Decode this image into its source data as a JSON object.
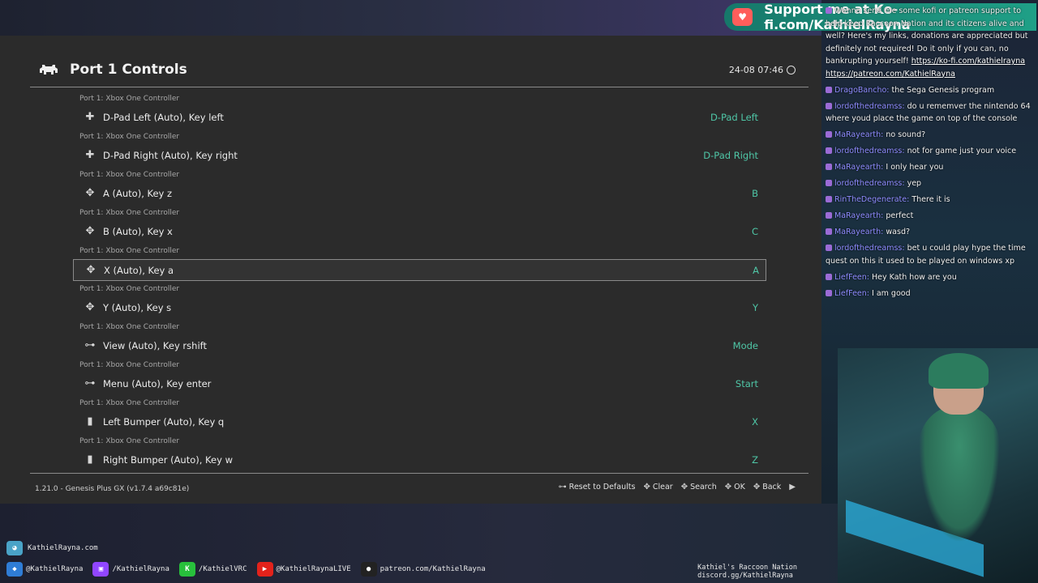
{
  "window": {
    "title": "Port 1 Controls",
    "clock": "24-08 07:46",
    "version": "1.21.0 - Genesis Plus GX (v1.7.4 a69c81e)"
  },
  "entries": [
    {
      "sub": "Port 1: Xbox One Controller",
      "label": "D-Pad Left (Auto), Key left",
      "value": "D-Pad Left",
      "icon": "dpad-left-icon"
    },
    {
      "sub": "Port 1: Xbox One Controller",
      "label": "D-Pad Right (Auto), Key right",
      "value": "D-Pad Right",
      "icon": "dpad-right-icon"
    },
    {
      "sub": "Port 1: Xbox One Controller",
      "label": "A (Auto), Key z",
      "value": "B",
      "icon": "face-button-icon"
    },
    {
      "sub": "Port 1: Xbox One Controller",
      "label": "B (Auto), Key x",
      "value": "C",
      "icon": "face-button-icon"
    },
    {
      "sub": "Port 1: Xbox One Controller",
      "label": "X (Auto), Key a",
      "value": "A",
      "icon": "face-button-icon",
      "selected": true
    },
    {
      "sub": "Port 1: Xbox One Controller",
      "label": "Y (Auto), Key s",
      "value": "Y",
      "icon": "face-button-icon"
    },
    {
      "sub": "Port 1: Xbox One Controller",
      "label": "View (Auto), Key rshift",
      "value": "Mode",
      "icon": "select-button-icon"
    },
    {
      "sub": "Port 1: Xbox One Controller",
      "label": "Menu (Auto), Key enter",
      "value": "Start",
      "icon": "start-button-icon"
    },
    {
      "sub": "Port 1: Xbox One Controller",
      "label": "Left Bumper (Auto), Key q",
      "value": "X",
      "icon": "bumper-icon"
    },
    {
      "sub": "Port 1: Xbox One Controller",
      "label": "Right Bumper (Auto), Key w",
      "value": "Z",
      "icon": "bumper-icon"
    }
  ],
  "footer": {
    "reset": "Reset to Defaults",
    "clear": "Clear",
    "search": "Search",
    "ok": "OK",
    "back": "Back"
  },
  "kofi": {
    "text": "Support me at Ko-fi.com/KathielRayna"
  },
  "chat": [
    {
      "user": "",
      "text": "Wanna send me some kofi or patreon support to help keep Raccoon Nation and its citizens alive and well? Here's my links, donations are appreciated but definitely not required! Do it only if you can, no bankrupting yourself!",
      "link1": "https://ko-fi.com/kathielrayna",
      "link2": "https://patreon.com/KathielRayna"
    },
    {
      "user": "DragoBancho:",
      "text": "the Sega Genesis program"
    },
    {
      "user": "lordofthedreamss:",
      "text": "do u rememver the nintendo 64 where youd place the game on top of the console"
    },
    {
      "user": "MaRayearth:",
      "text": "no sound?"
    },
    {
      "user": "lordofthedreamss:",
      "text": "not for game just your voice"
    },
    {
      "user": "MaRayearth:",
      "text": "I only hear you"
    },
    {
      "user": "lordofthedreamss:",
      "text": "yep"
    },
    {
      "user": "RinTheDegenerate:",
      "text": "There it is"
    },
    {
      "user": "MaRayearth:",
      "text": "perfect"
    },
    {
      "user": "MaRayearth:",
      "text": "wasd?"
    },
    {
      "user": "lordofthedreamss:",
      "text": "bet u could play hype the time quest on this it used to be played on windows xp"
    },
    {
      "user": "LiefFeen:",
      "text": "Hey Kath how are you"
    },
    {
      "user": "LiefFeen:",
      "text": "I am good"
    }
  ],
  "socials": {
    "site": "KathielRayna.com",
    "items": [
      {
        "handle": "@KathielRayna",
        "icon": "bluesky-icon",
        "color": "#2f7dd6"
      },
      {
        "handle": "/KathielRayna",
        "icon": "twitch-icon",
        "color": "#9146ff"
      },
      {
        "handle": "/KathielVRC",
        "icon": "kick-icon",
        "color": "#28c03c"
      },
      {
        "handle": "@KathielRaynaLIVE",
        "icon": "youtube-icon",
        "color": "#e3221b"
      },
      {
        "handle": "patreon.com/KathielRayna",
        "icon": "patreon-icon",
        "color": "#222222"
      }
    ],
    "discord_title": "Kathiel's Raccoon Nation",
    "discord_link": "discord.gg/KathielRayna"
  }
}
